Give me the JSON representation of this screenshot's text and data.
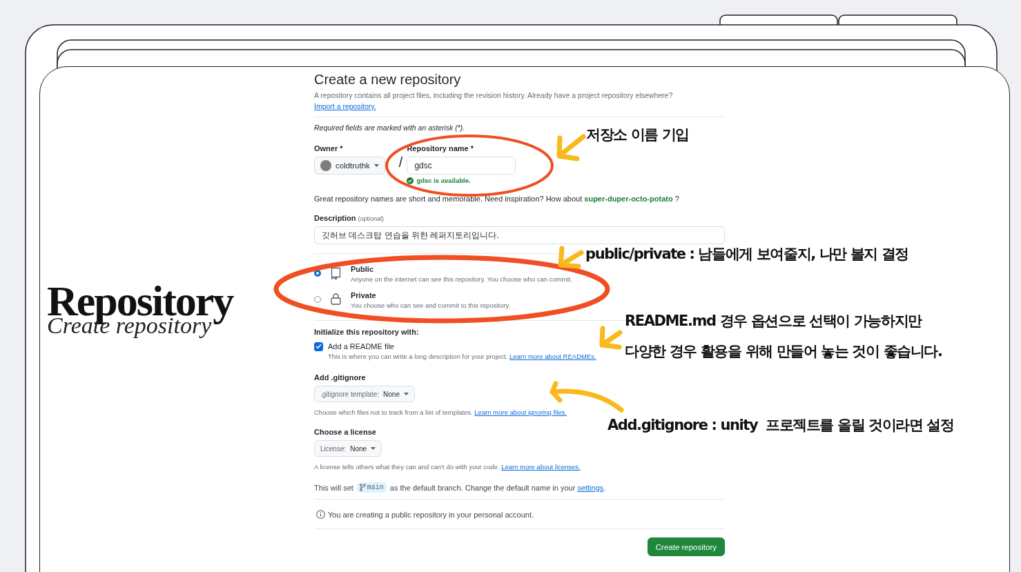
{
  "slide_title": {
    "heading": "Repository",
    "subheading": "Create repository"
  },
  "form": {
    "title": "Create a new repository",
    "intro": "A repository contains all project files, including the revision history. Already have a project repository elsewhere?",
    "import_link": "Import a repository.",
    "required_note": "Required fields are marked with an asterisk (*).",
    "owner": {
      "label": "Owner *",
      "value": "coldtruthk"
    },
    "separator": "/",
    "repo_name": {
      "label": "Repository name *",
      "value": "gdsc",
      "status": "gdsc is available."
    },
    "suggestion": "Great repository names are short and memorable. Need inspiration? How about **super-duper-octo-potato** ?",
    "description": {
      "label": "Description",
      "hint": "(optional)",
      "value": "깃허브 데스크탑 연습을 위한 레퍼지토리입니다."
    },
    "visibility": [
      {
        "kind": "public",
        "label": "Public",
        "detail": "Anyone on the internet can see this repository. You choose who can commit.",
        "selected": true
      },
      {
        "kind": "private",
        "label": "Private",
        "detail": "You choose who can see and commit to this repository.",
        "selected": false
      }
    ],
    "initialize": {
      "heading": "Initialize this repository with:",
      "readme": {
        "label": "Add a README file",
        "checked": true,
        "detail": "This is where you can write a long description for your project.",
        "link": "Learn more about READMEs."
      }
    },
    "gitignore": {
      "heading": "Add .gitignore",
      "select_label": ".gitignore template:",
      "select_value": "None",
      "detail": "Choose which files not to track from a list of templates.",
      "link": "Learn more about ignoring files."
    },
    "license": {
      "heading": "Choose a license",
      "select_label": "License:",
      "select_value": "None",
      "detail": "A license tells others what they can and can't do with your code.",
      "link": "Learn more about licenses."
    },
    "branch_note": {
      "before": "This will set",
      "branch": "main",
      "after": "as the default branch. Change the default name in your",
      "link": "settings",
      "end": "."
    },
    "info": "You are creating a public repository in your personal account.",
    "submit": "Create repository"
  },
  "annotations": [
    {
      "lines": [
        "저장소 이름 기입"
      ]
    },
    {
      "lines": [
        "public/private : 남들에게 보여줄지, 나만 볼지 결정"
      ]
    },
    {
      "lines": [
        "README.md 경우 옵션으로 선택이 가능하지만",
        "다양한 경우 활용을 위해 만들어 놓는 것이 좋습니다."
      ]
    },
    {
      "lines": [
        "Add.gitignore : unity  프로젝트를 올릴 것이라면 설정"
      ]
    }
  ]
}
